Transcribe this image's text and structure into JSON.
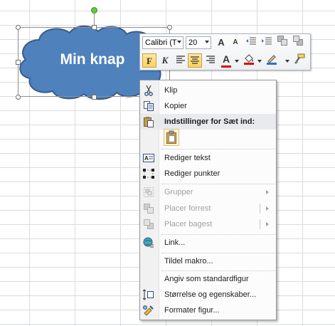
{
  "shape": {
    "text": "Min knap",
    "fill_color": "#4f81bd",
    "outline_color": "#385d8a"
  },
  "mini_toolbar": {
    "font_name": "Calibri (T",
    "font_size": "20",
    "grow_font_icon": "A",
    "shrink_font_icon": "A",
    "bold_label": "F",
    "italic_label": "K",
    "font_color": "A",
    "font_color_swatch": "#e00000",
    "fill_color_swatch": "#e00000",
    "line_color_swatch": "#3c6fb6",
    "icons": [
      "grow-font-icon",
      "shrink-font-icon",
      "decrease-indent-icon",
      "increase-indent-icon",
      "bring-forward-icon",
      "send-backward-icon",
      "bold-icon",
      "italic-icon",
      "align-left-icon",
      "align-center-icon",
      "align-right-icon",
      "font-color-icon",
      "fill-color-icon",
      "line-color-icon",
      "format-painter-icon"
    ]
  },
  "context_menu": {
    "items": [
      {
        "label": "Klip",
        "icon": "scissors-icon",
        "enabled": true
      },
      {
        "label": "Kopier",
        "icon": "copy-icon",
        "enabled": true
      },
      {
        "label": "Indstillinger for Sæt ind:",
        "icon": "paste-icon",
        "enabled": true,
        "header": true
      },
      {
        "label": "Rediger tekst",
        "icon": "edit-text-icon",
        "enabled": true
      },
      {
        "label": "Rediger punkter",
        "icon": "edit-points-icon",
        "enabled": true
      },
      {
        "label": "Grupper",
        "icon": "group-icon",
        "enabled": false,
        "submenu": true
      },
      {
        "label": "Placer forrest",
        "icon": "bring-front-icon",
        "enabled": false,
        "submenu": true
      },
      {
        "label": "Placer bagest",
        "icon": "send-back-icon",
        "enabled": false,
        "submenu": true
      },
      {
        "label": "Link...",
        "icon": "link-icon",
        "enabled": true
      },
      {
        "label": "Tildel makro...",
        "icon": "",
        "enabled": true
      },
      {
        "label": "Angiv som standardfigur",
        "icon": "",
        "enabled": true
      },
      {
        "label": "Størrelse og egenskaber...",
        "icon": "size-icon",
        "enabled": true
      },
      {
        "label": "Formater figur...",
        "icon": "format-shape-icon",
        "enabled": true
      }
    ]
  }
}
